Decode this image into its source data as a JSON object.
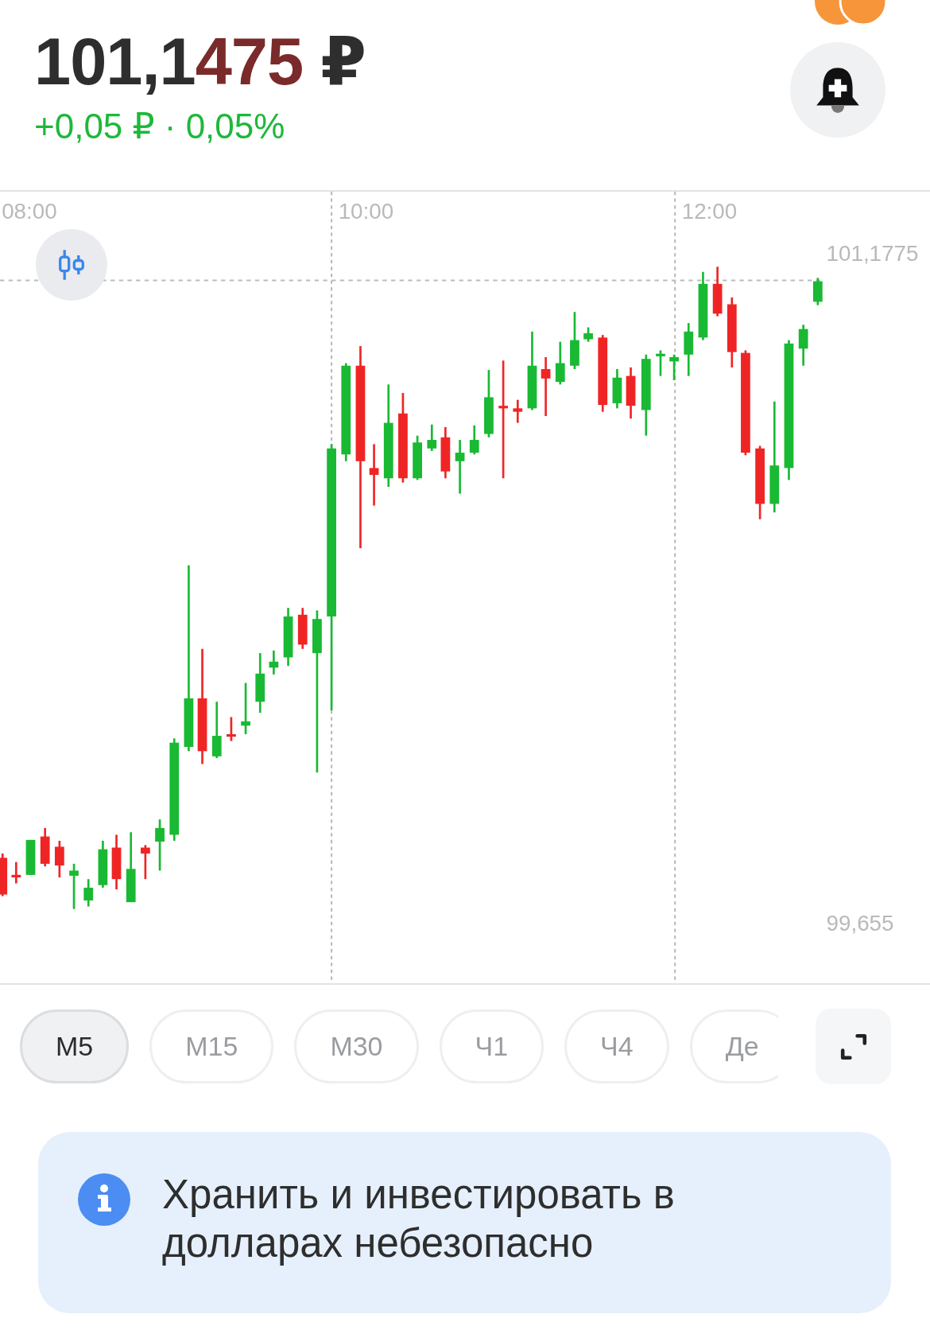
{
  "header": {
    "price": {
      "main": "101,1",
      "changed_digits": "475",
      "currency": "₽"
    },
    "change": "+0,05 ₽ · 0,05%"
  },
  "chart": {
    "time_labels": [
      "08:00",
      "10:00",
      "12:00"
    ],
    "price_labels": [
      "101,1775",
      "99,655"
    ]
  },
  "timeframes": [
    {
      "label": "M5",
      "selected": true
    },
    {
      "label": "M15",
      "selected": false
    },
    {
      "label": "M30",
      "selected": false
    },
    {
      "label": "Ч1",
      "selected": false
    },
    {
      "label": "Ч4",
      "selected": false
    },
    {
      "label": "Де",
      "selected": false
    }
  ],
  "notice": {
    "text": "Хранить и инвестировать в долларах небезопасно"
  }
}
